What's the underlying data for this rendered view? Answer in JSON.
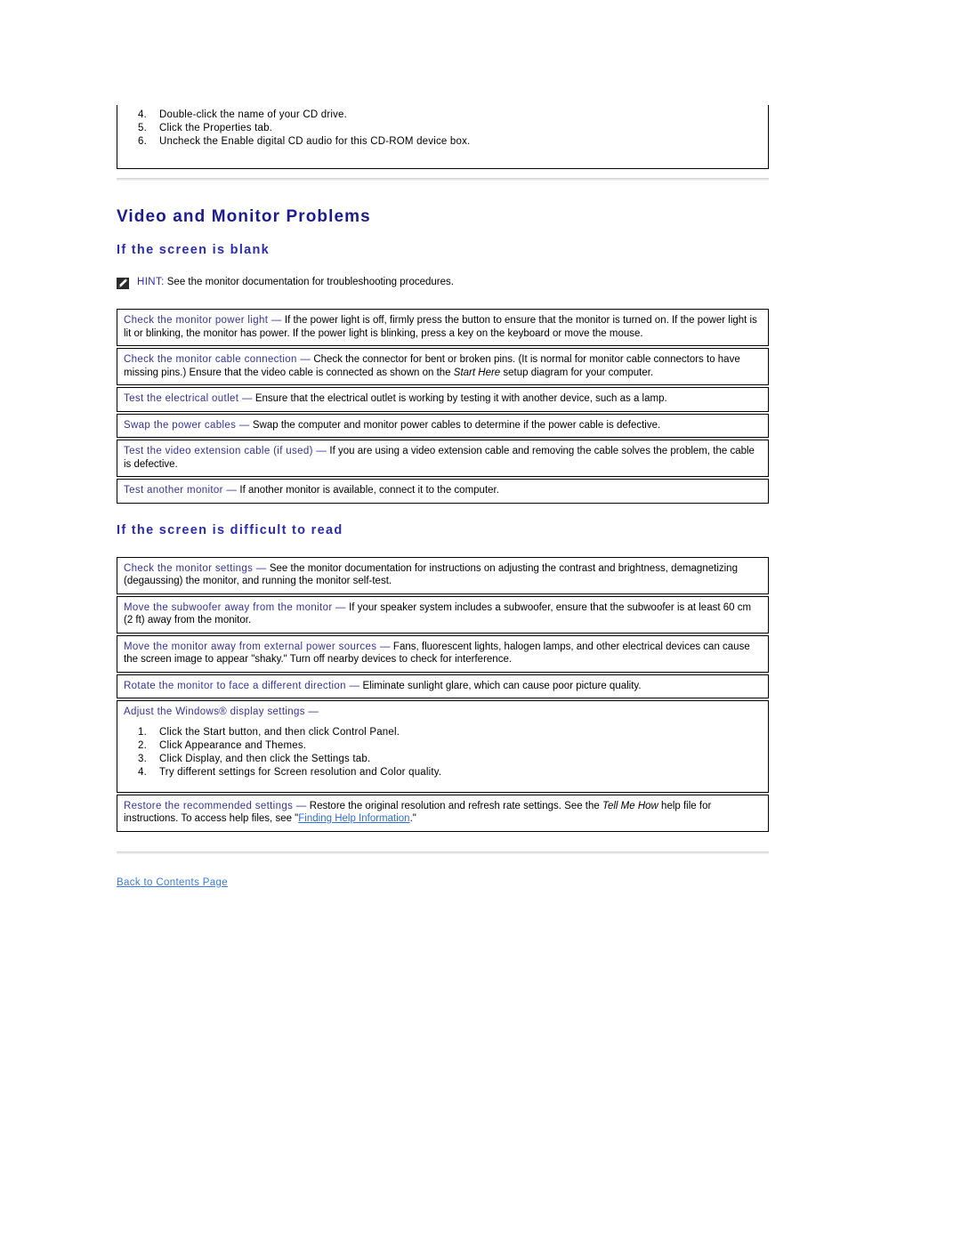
{
  "continued_steps": {
    "items": [
      {
        "num": "4.",
        "text": "Double-click the name of your CD drive."
      },
      {
        "num": "5.",
        "text": "Click the Properties tab."
      },
      {
        "num": "6.",
        "text": "Uncheck the Enable digital CD audio for this CD-ROM device box."
      }
    ]
  },
  "headings": {
    "title": "Video and Monitor Problems",
    "section_blank": "If the screen is blank",
    "section_difficult": "If the screen is difficult to read"
  },
  "hint": {
    "icon": "note-pencil-icon",
    "label": "HINT:",
    "text": "See the monitor documentation for troubleshooting procedures."
  },
  "blank_screen_items": [
    {
      "label": "Check the monitor power light —",
      "text": " If the power light is off, firmly press the button to ensure that the monitor is turned on. If the power light is lit or blinking, the monitor has power. If the power light is blinking, press a key on the keyboard or move the mouse."
    },
    {
      "label": "Check the monitor cable connection —",
      "text_before": " Check the connector for bent or broken pins. (It is normal for monitor cable connectors to have missing pins.) Ensure that the video cable is connected as shown on the ",
      "italic": "Start Here",
      "text_after": " setup diagram for your computer."
    },
    {
      "label": "Test the electrical outlet —",
      "text": " Ensure that the electrical outlet is working by testing it with another device, such as a lamp."
    },
    {
      "label": "Swap the power cables —",
      "text": " Swap the computer and monitor power cables to determine if the power cable is defective."
    },
    {
      "label": "Test the video extension cable (if used) —",
      "text": " If you are using a video extension cable and removing the cable solves the problem, the cable is defective."
    },
    {
      "label": "Test another monitor —",
      "text": " If another monitor is available, connect it to the computer."
    }
  ],
  "difficult_screen_items": [
    {
      "label": "Check the monitor settings —",
      "text": " See the monitor documentation for instructions on adjusting the contrast and brightness, demagnetizing (degaussing) the monitor, and running the monitor self-test."
    },
    {
      "label": "Move the subwoofer away from the monitor —",
      "text": " If your speaker system includes a subwoofer, ensure that the subwoofer is at least 60 cm (2 ft) away from the monitor."
    },
    {
      "label": "Move the monitor away from external power sources —",
      "text": " Fans, fluorescent lights, halogen lamps, and other electrical devices can cause the screen image to appear \"shaky.\" Turn off nearby devices to check for interference."
    },
    {
      "label": "Rotate the monitor to face a different direction —",
      "text": " Eliminate sunlight glare, which can cause poor picture quality."
    }
  ],
  "display_settings": {
    "label": "Adjust the Windows® display settings —",
    "steps": [
      {
        "num": "1.",
        "text": "Click the Start button, and then click Control Panel."
      },
      {
        "num": "2.",
        "text": "Click Appearance and Themes."
      },
      {
        "num": "3.",
        "text": "Click Display, and then click the Settings tab."
      },
      {
        "num": "4.",
        "text": "Try different settings for Screen resolution and Color quality."
      }
    ]
  },
  "restore_settings": {
    "label": "Restore the recommended settings —",
    "text_before": " Restore the original resolution and refresh rate settings. See the ",
    "italic": "Tell Me How",
    "text_middle": " help file for instructions. To access help files, see \"",
    "link": "Finding Help Information",
    "text_after": ".\""
  },
  "footer": {
    "back_link": "Back to Contents Page"
  },
  "colors": {
    "heading": "#1b1b8f",
    "subheading": "#2b2bb0",
    "label": "#33339a",
    "link": "#2f6fd0",
    "contents_link": "#3a7ae0",
    "border": "#000000",
    "rule": "#e6e6e6"
  }
}
